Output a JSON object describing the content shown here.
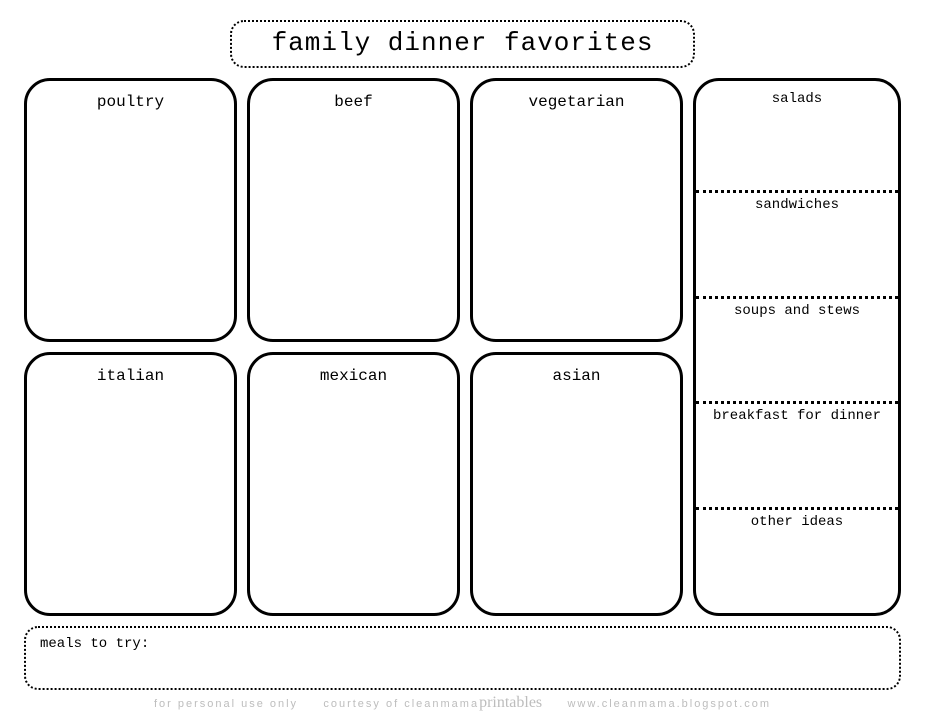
{
  "title": "family dinner favorites",
  "cards": [
    {
      "label": "poultry"
    },
    {
      "label": "beef"
    },
    {
      "label": "vegetarian"
    },
    {
      "label": "italian"
    },
    {
      "label": "mexican"
    },
    {
      "label": "asian"
    }
  ],
  "side_sections": [
    {
      "label": "salads"
    },
    {
      "label": "sandwiches"
    },
    {
      "label": "soups and stews"
    },
    {
      "label": "breakfast for dinner"
    },
    {
      "label": "other ideas"
    }
  ],
  "meals_label": "meals to try:",
  "footer": {
    "part1": "for personal use only",
    "part2": "courtesy of cleanmama",
    "accent": "printables",
    "part3": "www.cleanmama.blogspot.com"
  }
}
